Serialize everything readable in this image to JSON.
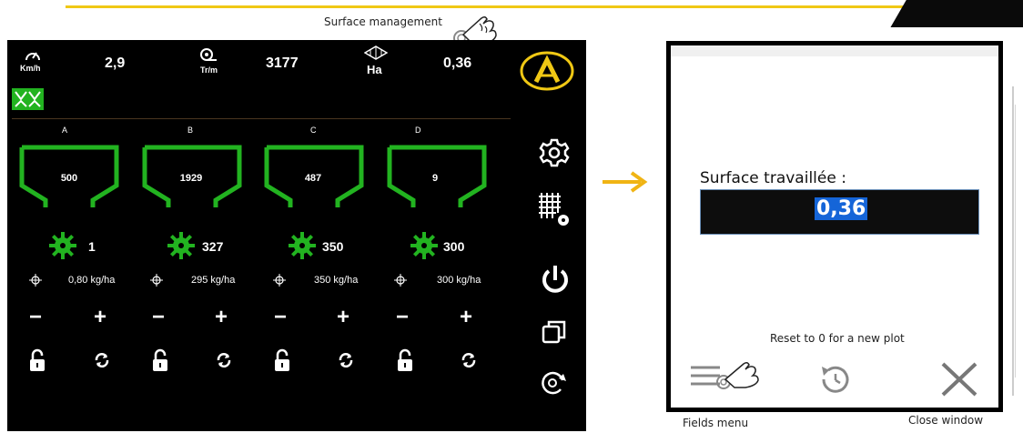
{
  "header": {
    "surface_label": "Surface management"
  },
  "stats": {
    "speed_unit": "Km/h",
    "speed_value": "2,9",
    "rpm_unit": "Tr/m",
    "rpm_value": "3177",
    "area_unit": "Ha",
    "area_value": "0,36"
  },
  "hoppers": [
    {
      "label": "A",
      "value": "500",
      "count": "1",
      "rate": "0,80 kg/ha"
    },
    {
      "label": "B",
      "value": "1929",
      "count": "327",
      "rate": "295 kg/ha"
    },
    {
      "label": "C",
      "value": "487",
      "count": "350",
      "rate": "350 kg/ha"
    },
    {
      "label": "D",
      "value": "9",
      "count": "300",
      "rate": "300 kg/ha"
    }
  ],
  "controls": {
    "minus": "−",
    "plus": "+"
  },
  "dialog": {
    "field_label": "Surface travaillée :",
    "value": "0,36",
    "reset_text": "Reset to 0 for a new plot"
  },
  "labels": {
    "fields_menu": "Fields menu",
    "close_window": "Close window"
  },
  "colors": {
    "accent": "#f0c814",
    "hopper": "#22b320",
    "panel": "#000000",
    "highlight": "#1565d8"
  },
  "icons": [
    "speedometer-icon",
    "rpm-icon",
    "area-icon",
    "brand-logo",
    "seed-mode-icon",
    "gear-icon",
    "calibration-icon",
    "power-icon",
    "windows-icon",
    "rotate-icon",
    "unlock-icon",
    "refresh-icon",
    "target-icon",
    "menu-icon",
    "reset-icon",
    "close-icon",
    "hand-pointer-icon"
  ]
}
